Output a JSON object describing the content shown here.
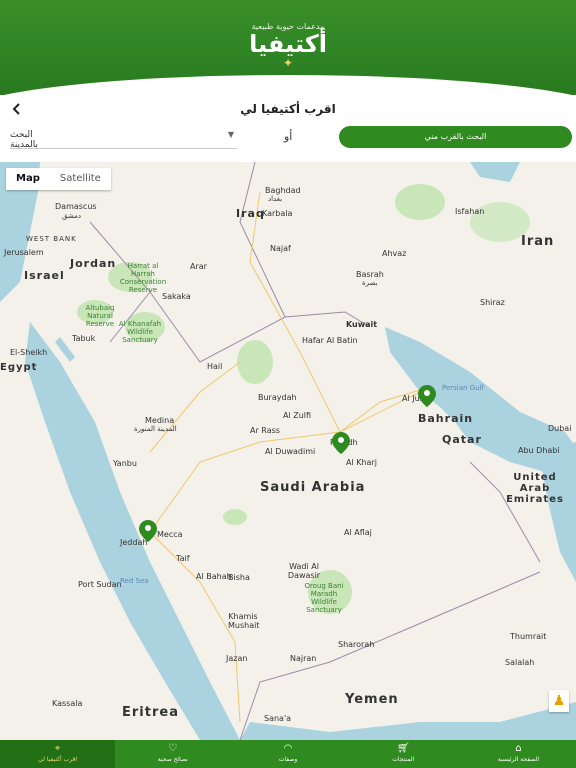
{
  "header": {
    "tagline": "مدعمات حيوية طبيعية",
    "brand": "أكتيفيا",
    "colors": {
      "brand_green": "#2f8a1f"
    }
  },
  "page": {
    "title": "اقرب أكتيفيا لي",
    "back_icon": "chevron-left-icon"
  },
  "search": {
    "nearby_button": "البحث بالقرب مني",
    "or": "أو",
    "city_select": "البحث بالمدينة"
  },
  "map": {
    "type_map": "Map",
    "type_satellite": "Satellite",
    "labels": {
      "damascus": "Damascus",
      "damascus_ar": "دمشق",
      "westbank": "WEST BANK",
      "jerusalem": "Jerusalem",
      "israel": "Israel",
      "jordan": "Jordan",
      "baghdad": "Baghdad",
      "baghdad_ar": "بغداد",
      "iraq": "Iraq",
      "karbala": "Karbala",
      "najaf": "Najaf",
      "isfahan": "Isfahan",
      "iran": "Iran",
      "ahvaz": "Ahvaz",
      "basrah": "Basrah",
      "basrah_ar": "بصرة",
      "shiraz": "Shiraz",
      "kuwait": "Kuwait",
      "hafar": "Hafar Al Batin",
      "harrat": "Harrat al Harrah Conservation Reserve",
      "sakaka": "Sakaka",
      "altubaiq": "Altubaiq Natural Reserve",
      "khanafah": "Al Khanafah Wildlife Sanctuary",
      "tabuk": "Tabuk",
      "elsheikh": "El-Sheikh",
      "arar": "Arar",
      "hail": "Hail",
      "buraydah": "Buraydah",
      "zulfi": "Al Zulfi",
      "rass": "Ar Rass",
      "duwadimi": "Al Duwadimi",
      "persian_gulf": "Persian Gulf",
      "bahrain": "Bahrain",
      "qatar": "Qatar",
      "dubai": "Dubai",
      "abudhabi": "Abu Dhabi",
      "uae": "United Arab Emirates",
      "medina": "Medina",
      "medina_ar": "المدينة المنورة",
      "yanbu": "Yanbu",
      "saudi": "Saudi Arabia",
      "riyadh": "Riyadh",
      "alkharj": "Al Kharj",
      "jeddah": "Jeddah",
      "mecca": "Mecca",
      "taif": "Taif",
      "red_sea": "Red Sea",
      "port_sudan": "Port Sudan",
      "aflaj": "Al Aflaj",
      "wadi": "Wadi Al Dawasir",
      "orug": "Oroug Bani Maradh Wildlife Sanctuary",
      "baha": "Al Bahah",
      "bisha": "Bisha",
      "khamis": "Khamis Mushait",
      "jazan": "Jazan",
      "najran": "Najran",
      "sharorah": "Sharorah",
      "yemen": "Yemen",
      "sanaa": "Sana'a",
      "eritrea": "Eritrea",
      "kassala": "Kassala",
      "salalah": "Salalah",
      "thumrait": "Thumrait",
      "aljubail": "Al Jubail",
      "egypt": "Egypt"
    },
    "pins": [
      {
        "name": "Al Jubail"
      },
      {
        "name": "Riyadh"
      },
      {
        "name": "Jeddah"
      }
    ]
  },
  "nav": [
    {
      "label": "الصفحة الرئيسية",
      "icon": "home-icon"
    },
    {
      "label": "المنتجات",
      "icon": "cart-icon"
    },
    {
      "label": "وصفات",
      "icon": "dish-icon"
    },
    {
      "label": "نصائح صحية",
      "icon": "heart-icon"
    },
    {
      "label": "اقرب أكتيفيا لي",
      "icon": "location-icon",
      "active": true
    }
  ]
}
